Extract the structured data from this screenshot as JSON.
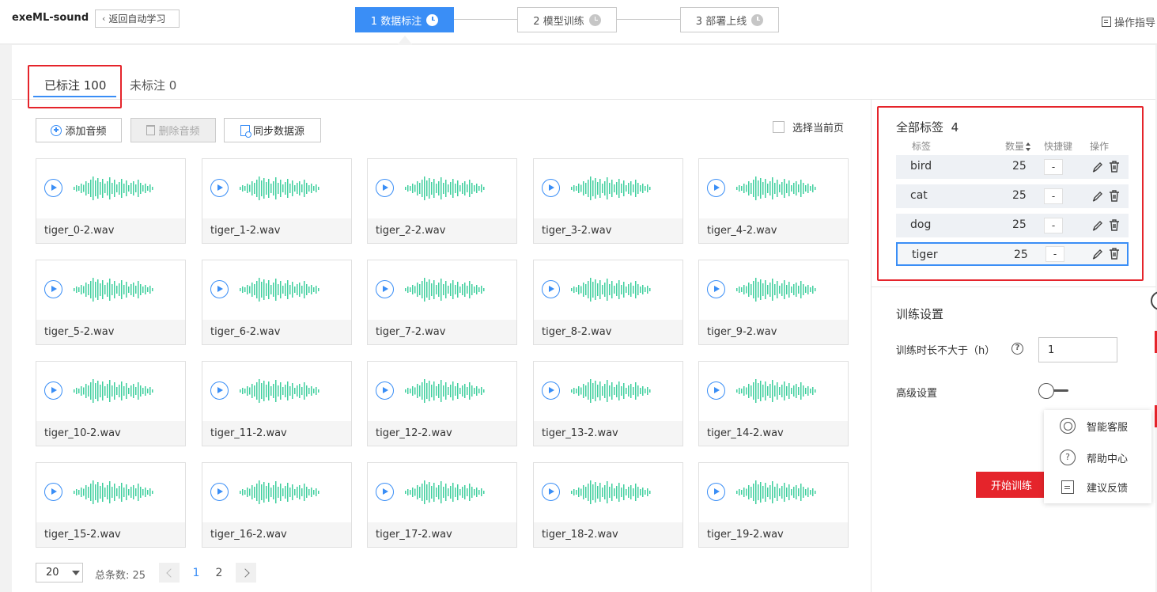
{
  "app": {
    "title": "exeML-sound",
    "back_label": "返回自动学习",
    "guide_label": "操作指导"
  },
  "steps": [
    {
      "label": "1 数据标注",
      "active": true
    },
    {
      "label": "2 模型训练",
      "active": false
    },
    {
      "label": "3 部署上线",
      "active": false
    }
  ],
  "tabs": {
    "labeled": "已标注 100",
    "unlabeled": "未标注 0"
  },
  "toolbar": {
    "add": "添加音频",
    "delete": "删除音频",
    "sync": "同步数据源",
    "select_page": "选择当前页"
  },
  "files": [
    "tiger_0-2.wav",
    "tiger_1-2.wav",
    "tiger_2-2.wav",
    "tiger_3-2.wav",
    "tiger_4-2.wav",
    "tiger_5-2.wav",
    "tiger_6-2.wav",
    "tiger_7-2.wav",
    "tiger_8-2.wav",
    "tiger_9-2.wav",
    "tiger_10-2.wav",
    "tiger_11-2.wav",
    "tiger_12-2.wav",
    "tiger_13-2.wav",
    "tiger_14-2.wav",
    "tiger_15-2.wav",
    "tiger_16-2.wav",
    "tiger_17-2.wav",
    "tiger_18-2.wav",
    "tiger_19-2.wav"
  ],
  "pagination": {
    "page_size": "20",
    "total": "总条数: 25",
    "pages": [
      "1",
      "2"
    ],
    "current": "1"
  },
  "labels_panel": {
    "title": "全部标签",
    "count": "4",
    "headers": {
      "label": "标签",
      "count": "数量",
      "hotkey": "快捷键",
      "ops": "操作"
    },
    "rows": [
      {
        "name": "bird",
        "count": "25",
        "hotkey": "-"
      },
      {
        "name": "cat",
        "count": "25",
        "hotkey": "-"
      },
      {
        "name": "dog",
        "count": "25",
        "hotkey": "-"
      },
      {
        "name": "tiger",
        "count": "25",
        "hotkey": "-"
      }
    ]
  },
  "training": {
    "title": "训练设置",
    "duration_label": "训练时长不大于（h）",
    "duration_value": "1",
    "advanced_label": "高级设置",
    "advanced_enabled": false,
    "start_label": "开始训练"
  },
  "float_menu": [
    {
      "label": "智能客服",
      "icon": "customer-service-icon"
    },
    {
      "label": "帮助中心",
      "icon": "help-circle-icon"
    },
    {
      "label": "建议反馈",
      "icon": "feedback-icon"
    }
  ],
  "colors": {
    "accent": "#3a8ef6",
    "danger": "#e5242b",
    "wave": "#3fcf9e"
  }
}
